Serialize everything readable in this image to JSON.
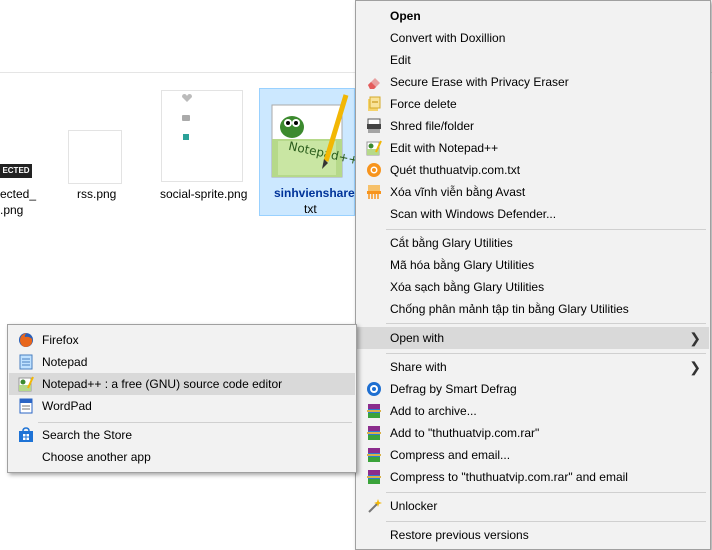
{
  "files": [
    {
      "name": "ected_",
      "name2": ".png",
      "badge": "ECTED"
    },
    {
      "name": "rss.png"
    },
    {
      "name": "social-sprite.png"
    },
    {
      "name": "sinhvienshare",
      "name2": "txt",
      "icon_text": "Notepad++"
    }
  ],
  "context_menu": {
    "group1": [
      {
        "label": "Open",
        "icon": ""
      },
      {
        "label": "Convert with Doxillion",
        "icon": ""
      },
      {
        "label": "Edit",
        "icon": ""
      },
      {
        "label": "Secure Erase with Privacy Eraser",
        "icon": "eraser-icon"
      },
      {
        "label": "Force delete",
        "icon": "force-delete-icon"
      },
      {
        "label": "Shred file/folder",
        "icon": "shredder-icon"
      },
      {
        "label": "Edit with Notepad++",
        "icon": "notepad-plus-icon"
      },
      {
        "label": "Quét thuthuatvip.com.txt",
        "icon": "avast-scan-icon"
      },
      {
        "label": "Xóa vĩnh viễn bằng Avast",
        "icon": "avast-shred-icon"
      },
      {
        "label": "Scan with Windows Defender...",
        "icon": ""
      }
    ],
    "group2": [
      {
        "label": "Cắt bằng Glary Utilities"
      },
      {
        "label": "Mã hóa bằng Glary Utilities"
      },
      {
        "label": "Xóa sạch bằng Glary Utilities"
      },
      {
        "label": "Chống phân mảnh tập tin bằng Glary Utilities"
      }
    ],
    "open_with": {
      "label": "Open with"
    },
    "group3": [
      {
        "label": "Share with",
        "icon": ""
      },
      {
        "label": "Defrag by Smart Defrag",
        "icon": "smart-defrag-icon"
      },
      {
        "label": "Add to archive...",
        "icon": "winrar-icon"
      },
      {
        "label": "Add to \"thuthuatvip.com.rar\"",
        "icon": "winrar-icon"
      },
      {
        "label": "Compress and email...",
        "icon": "winrar-icon"
      },
      {
        "label": "Compress to \"thuthuatvip.com.rar\" and email",
        "icon": "winrar-icon"
      }
    ],
    "unlocker": {
      "label": "Unlocker"
    },
    "restore": {
      "label": "Restore previous versions"
    }
  },
  "submenu": {
    "items": [
      {
        "label": "Firefox",
        "icon": "firefox-icon"
      },
      {
        "label": "Notepad",
        "icon": "notepad-icon"
      },
      {
        "label": "Notepad++ : a free (GNU) source code editor",
        "icon": "notepad-plus-icon"
      },
      {
        "label": "WordPad",
        "icon": "wordpad-icon"
      }
    ],
    "store": {
      "label": "Search the Store"
    },
    "another": {
      "label": "Choose another app"
    }
  },
  "colors": {
    "highlight": "#d9d9d9",
    "selected_file_bg": "#cce8ff"
  }
}
